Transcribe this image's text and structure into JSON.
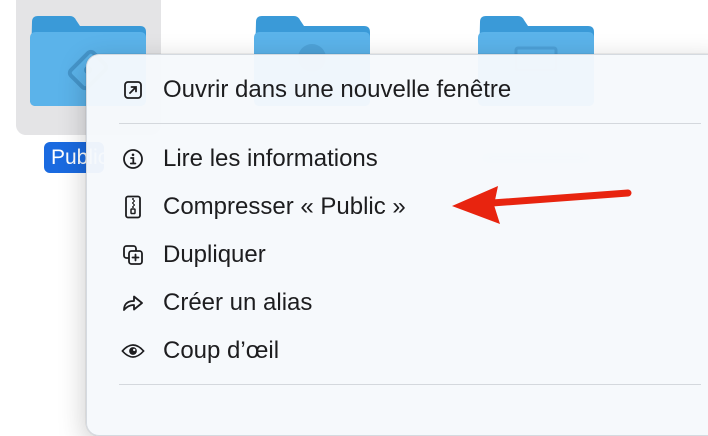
{
  "folders": [
    {
      "name": "Public"
    },
    {
      "name": ""
    },
    {
      "name": ""
    }
  ],
  "selected_folder_label": "Public",
  "context_menu": {
    "items": [
      {
        "label": "Ouvrir dans une nouvelle fenêtre",
        "icon": "open-in-new-window-icon"
      },
      {
        "label": "Lire les informations",
        "icon": "info-icon"
      },
      {
        "label": "Compresser « Public »",
        "icon": "zip-archive-icon"
      },
      {
        "label": "Dupliquer",
        "icon": "duplicate-icon"
      },
      {
        "label": "Créer un alias",
        "icon": "alias-arrow-icon"
      },
      {
        "label": "Coup d’œil",
        "icon": "eye-icon"
      }
    ]
  },
  "colors": {
    "folder": "#5bb3ea",
    "selection": "#1a6ae0",
    "annotation_arrow": "#e8240f"
  }
}
